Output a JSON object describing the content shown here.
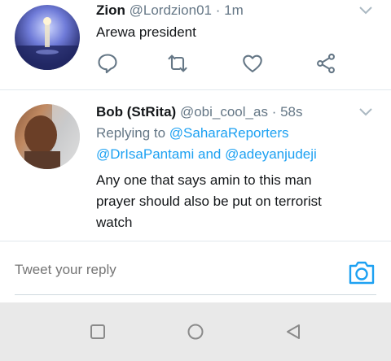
{
  "tweets": [
    {
      "name": "Zion",
      "handle": "@Lordzion01",
      "dot": "·",
      "time": "1m",
      "text": "Arewa president"
    },
    {
      "name": "Bob (StRita)",
      "handle": "@obi_cool_as",
      "dot": "·",
      "time": "58s",
      "replying_label": "Replying to",
      "reply_to_1": "@SaharaReporters",
      "reply_to_2": "@DrIsaPantami",
      "and_label": "and",
      "reply_to_3": "@adeyanjudeji",
      "text_line1": "Any one that says amin to this man",
      "text_line2": "prayer should also be put on terrorist",
      "text_line3": "watch"
    }
  ],
  "reply": {
    "placeholder": "Tweet your reply"
  },
  "icons": {
    "reply": "comment-icon",
    "retweet": "retweet-icon",
    "like": "heart-icon",
    "share": "share-icon",
    "camera": "camera-icon",
    "more": "chevron-down-icon"
  },
  "colors": {
    "accent": "#1da1f2",
    "muted": "#657786",
    "text": "#14171a",
    "navbar": "#e9e9e9"
  }
}
